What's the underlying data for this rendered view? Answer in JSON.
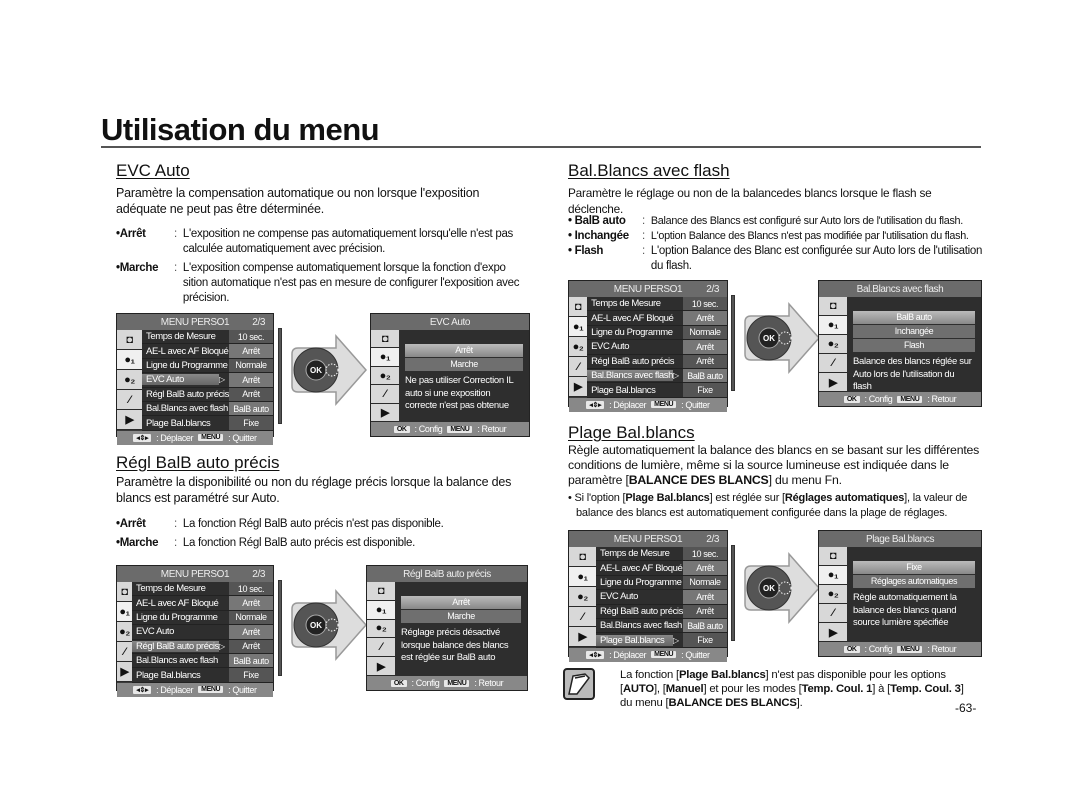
{
  "page": {
    "title": "Utilisation du menu",
    "page_number": "-63-"
  },
  "menu_common": {
    "header": "MENU PERSO1",
    "page_indicator": "2/3",
    "items": [
      {
        "label": "Temps de Mesure",
        "value": "10 sec."
      },
      {
        "label": "AE-L avec AF Bloqué",
        "value": "Arrêt"
      },
      {
        "label": "Ligne du Programme",
        "value": "Normale"
      },
      {
        "label": "EVC Auto",
        "value": "Arrêt"
      },
      {
        "label": "Régl BalB auto précis",
        "value": "Arrêt"
      },
      {
        "label": "Bal.Blancs avec flash",
        "value": "BalB auto"
      },
      {
        "label": "Plage Bal.blancs",
        "value": "Fixe"
      }
    ],
    "footer_move": ": Déplacer",
    "footer_menu_key": "MENU",
    "footer_quit": ": Quitter",
    "footer_ok_key": "OK",
    "footer_config": ": Config",
    "footer_back": ": Retour",
    "tab_icons": [
      "camera-icon",
      "user1-icon",
      "user2-icon",
      "wrench-icon",
      "play-icon"
    ],
    "dial_center": "OK"
  },
  "sections": {
    "evc": {
      "title": "EVC Auto",
      "intro": "Paramètre la compensation automatique ou non lorsque l'exposition adéquate ne peut pas être déterminée.",
      "bullets": [
        {
          "key": "•Arrêt",
          "text": "L'exposition ne compense pas automatiquement lorsqu'elle n'est pas calculée automatiquement avec précision."
        },
        {
          "key": "•Marche",
          "text": "L'exposition compense automatiquement lorsque la fonction d'expo sition automatique n'est pas en mesure de configurer l'exposition avec précision."
        }
      ],
      "submenu": {
        "title": "EVC Auto",
        "options": [
          "Arrêt",
          "Marche"
        ],
        "description": "Ne pas utiliser Correction IL auto si une exposition correcte n'est pas obtenue"
      }
    },
    "regl": {
      "title": "Régl BalB auto précis",
      "intro": "Paramètre la disponibilité ou non du réglage précis lorsque la balance des blancs est paramétré sur Auto.",
      "bullets": [
        {
          "key": "•Arrêt",
          "text": "La fonction Régl BalB auto précis n'est pas disponible."
        },
        {
          "key": "•Marche",
          "text": "La fonction Régl BalB auto précis est disponible."
        }
      ],
      "submenu": {
        "title": "Régl BalB auto précis",
        "options": [
          "Arrêt",
          "Marche"
        ],
        "description": "Réglage précis désactivé lorsque balance des blancs est réglée sur BalB auto"
      }
    },
    "flash": {
      "title": "Bal.Blancs avec flash",
      "intro": "Paramètre le réglage ou non de la balancedes blancs lorsque le flash se déclenche.",
      "bullets": [
        {
          "key": "• BalB auto",
          "text": "Balance des Blancs est configuré sur Auto lors de l'utilisation du flash."
        },
        {
          "key": "• Inchangée",
          "text": "L'option Balance des Blancs n'est pas modifiée par l'utilisation du flash."
        },
        {
          "key": "• Flash",
          "text": "L'option Balance des Blanc est configurée sur Auto lors de l'utilisation du flash."
        }
      ],
      "submenu": {
        "title": "Bal.Blancs avec flash",
        "options": [
          "BalB auto",
          "Inchangée",
          "Flash"
        ],
        "description": "Balance des blancs réglée sur Auto lors de l'utilisation du flash"
      }
    },
    "plage": {
      "title": "Plage Bal.blancs",
      "intro_1": "Règle automatiquement la balance des blancs en se basant sur les différentes conditions de lumière, même si la source lumineuse est indiquée dans le paramètre [",
      "intro_bold": "BALANCE DES BLANCS",
      "intro_2": "] du menu Fn.",
      "bullet_1": "• Si l'option [",
      "bullet_b1": "Plage Bal.blancs",
      "bullet_2": "] est réglée sur [",
      "bullet_b2": "Réglages automatiques",
      "bullet_3": "], la  valeur de balance des blancs est automatiquement configurée dans la plage de réglages.",
      "submenu": {
        "title": "Plage Bal.blancs",
        "options": [
          "Fixe",
          "Réglages automatiques"
        ],
        "description": "Règle automatiquement la balance des blancs quand source lumière spécifiée"
      },
      "note": {
        "t1": "La fonction [",
        "b1": "Plage Bal.blancs",
        "t2": "] n'est pas disponible pour les options [",
        "b2": "AUTO",
        "t3": "], [",
        "b3": "Manuel",
        "t4": "] et pour les modes [",
        "b4": "Temp. Coul. 1",
        "t5": "] à [",
        "b5": "Temp. Coul. 3",
        "t6": "] du menu [",
        "b6": "BALANCE DES BLANCS",
        "t7": "]."
      }
    }
  }
}
